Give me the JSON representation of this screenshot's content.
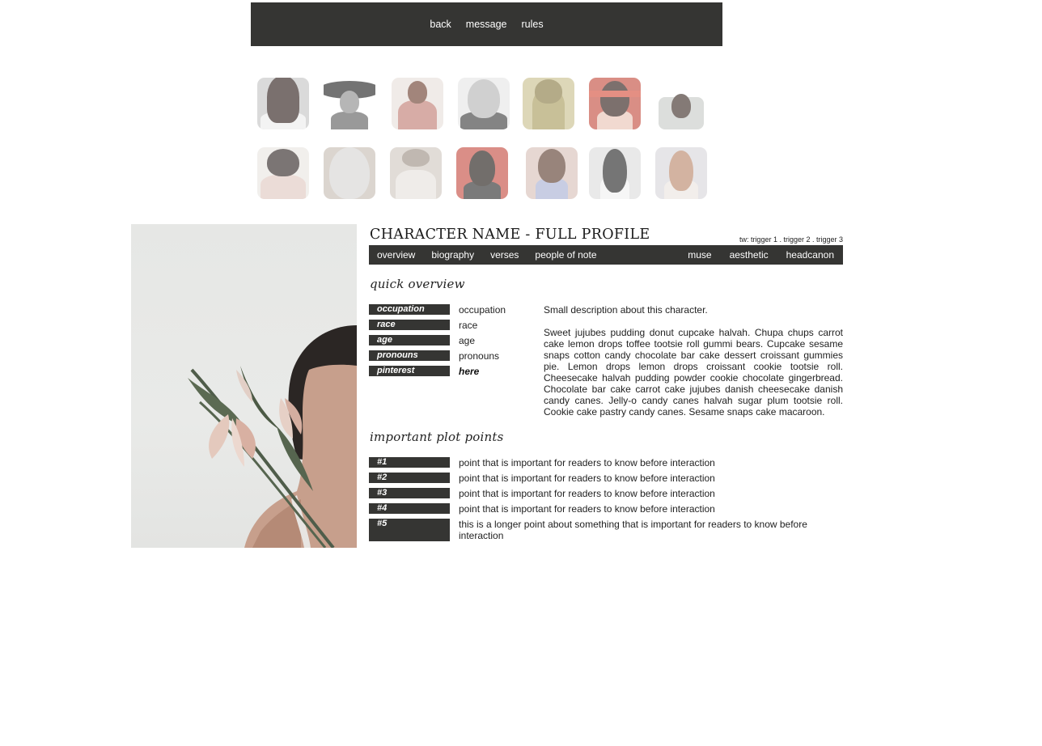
{
  "nav": {
    "links": [
      "back",
      "message",
      "rules"
    ]
  },
  "header": {
    "title": "CHARACTER NAME - FULL PROFILE",
    "triggers": "tw: trigger 1 . trigger 2 . trigger 3"
  },
  "tabs": {
    "left": [
      "overview",
      "biography",
      "verses",
      "people of note"
    ],
    "right": [
      "muse",
      "aesthetic",
      "headcanon"
    ]
  },
  "overview": {
    "heading": "quick overview",
    "rows": [
      {
        "label": "occupation",
        "value": "occupation"
      },
      {
        "label": "race",
        "value": "race"
      },
      {
        "label": "age",
        "value": "age"
      },
      {
        "label": "pronouns",
        "value": "pronouns"
      },
      {
        "label": "pinterest",
        "value": "here"
      }
    ],
    "short_description": "Small description about this character.",
    "long_description": "Sweet jujubes pudding donut cupcake halvah. Chupa chups carrot cake lemon drops toffee tootsie roll gummi bears. Cupcake sesame snaps cotton candy chocolate bar cake dessert croissant gummies pie. Lemon drops lemon drops croissant cookie tootsie roll. Cheesecake halvah pudding powder cookie chocolate gingerbread. Chocolate bar cake carrot cake jujubes danish cheesecake danish candy canes. Jelly-o candy canes halvah sugar plum tootsie roll. Cookie cake pastry candy canes. Sesame snaps cake macaroon."
  },
  "plot": {
    "heading": "important plot points",
    "points": [
      {
        "label": "#1",
        "text": "point that is important for readers to know before interaction"
      },
      {
        "label": "#2",
        "text": "point that is important for readers to know before interaction"
      },
      {
        "label": "#3",
        "text": "point that is important for readers to know before interaction"
      },
      {
        "label": "#4",
        "text": "point that is important for readers to know before interaction"
      },
      {
        "label": "#5",
        "text": "this is a longer point about something that is important for readers to know before interaction"
      }
    ]
  },
  "colors": {
    "dark_bar": "#353533",
    "page_bg": "#ffffff"
  }
}
